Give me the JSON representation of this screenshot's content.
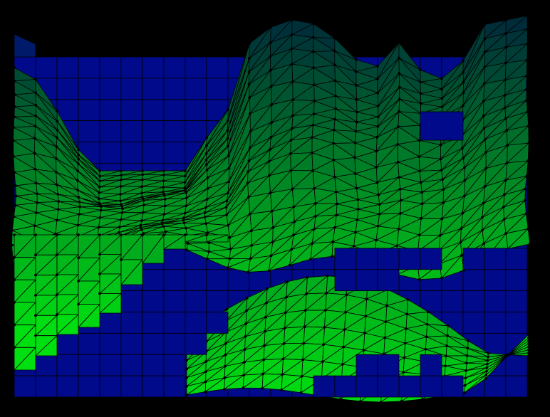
{
  "scene": {
    "background_color": "#000000",
    "colors": {
      "low_block": "#000a8a",
      "mesh_top": "#002a3a",
      "mesh_bottom": "#00e010",
      "edge": "#000000",
      "vertex": "#000000"
    },
    "grid": {
      "columns": 24,
      "rows": 18
    },
    "mesh": {
      "surfaces": 2,
      "triangulated": true,
      "vertices_visible": true
    }
  }
}
